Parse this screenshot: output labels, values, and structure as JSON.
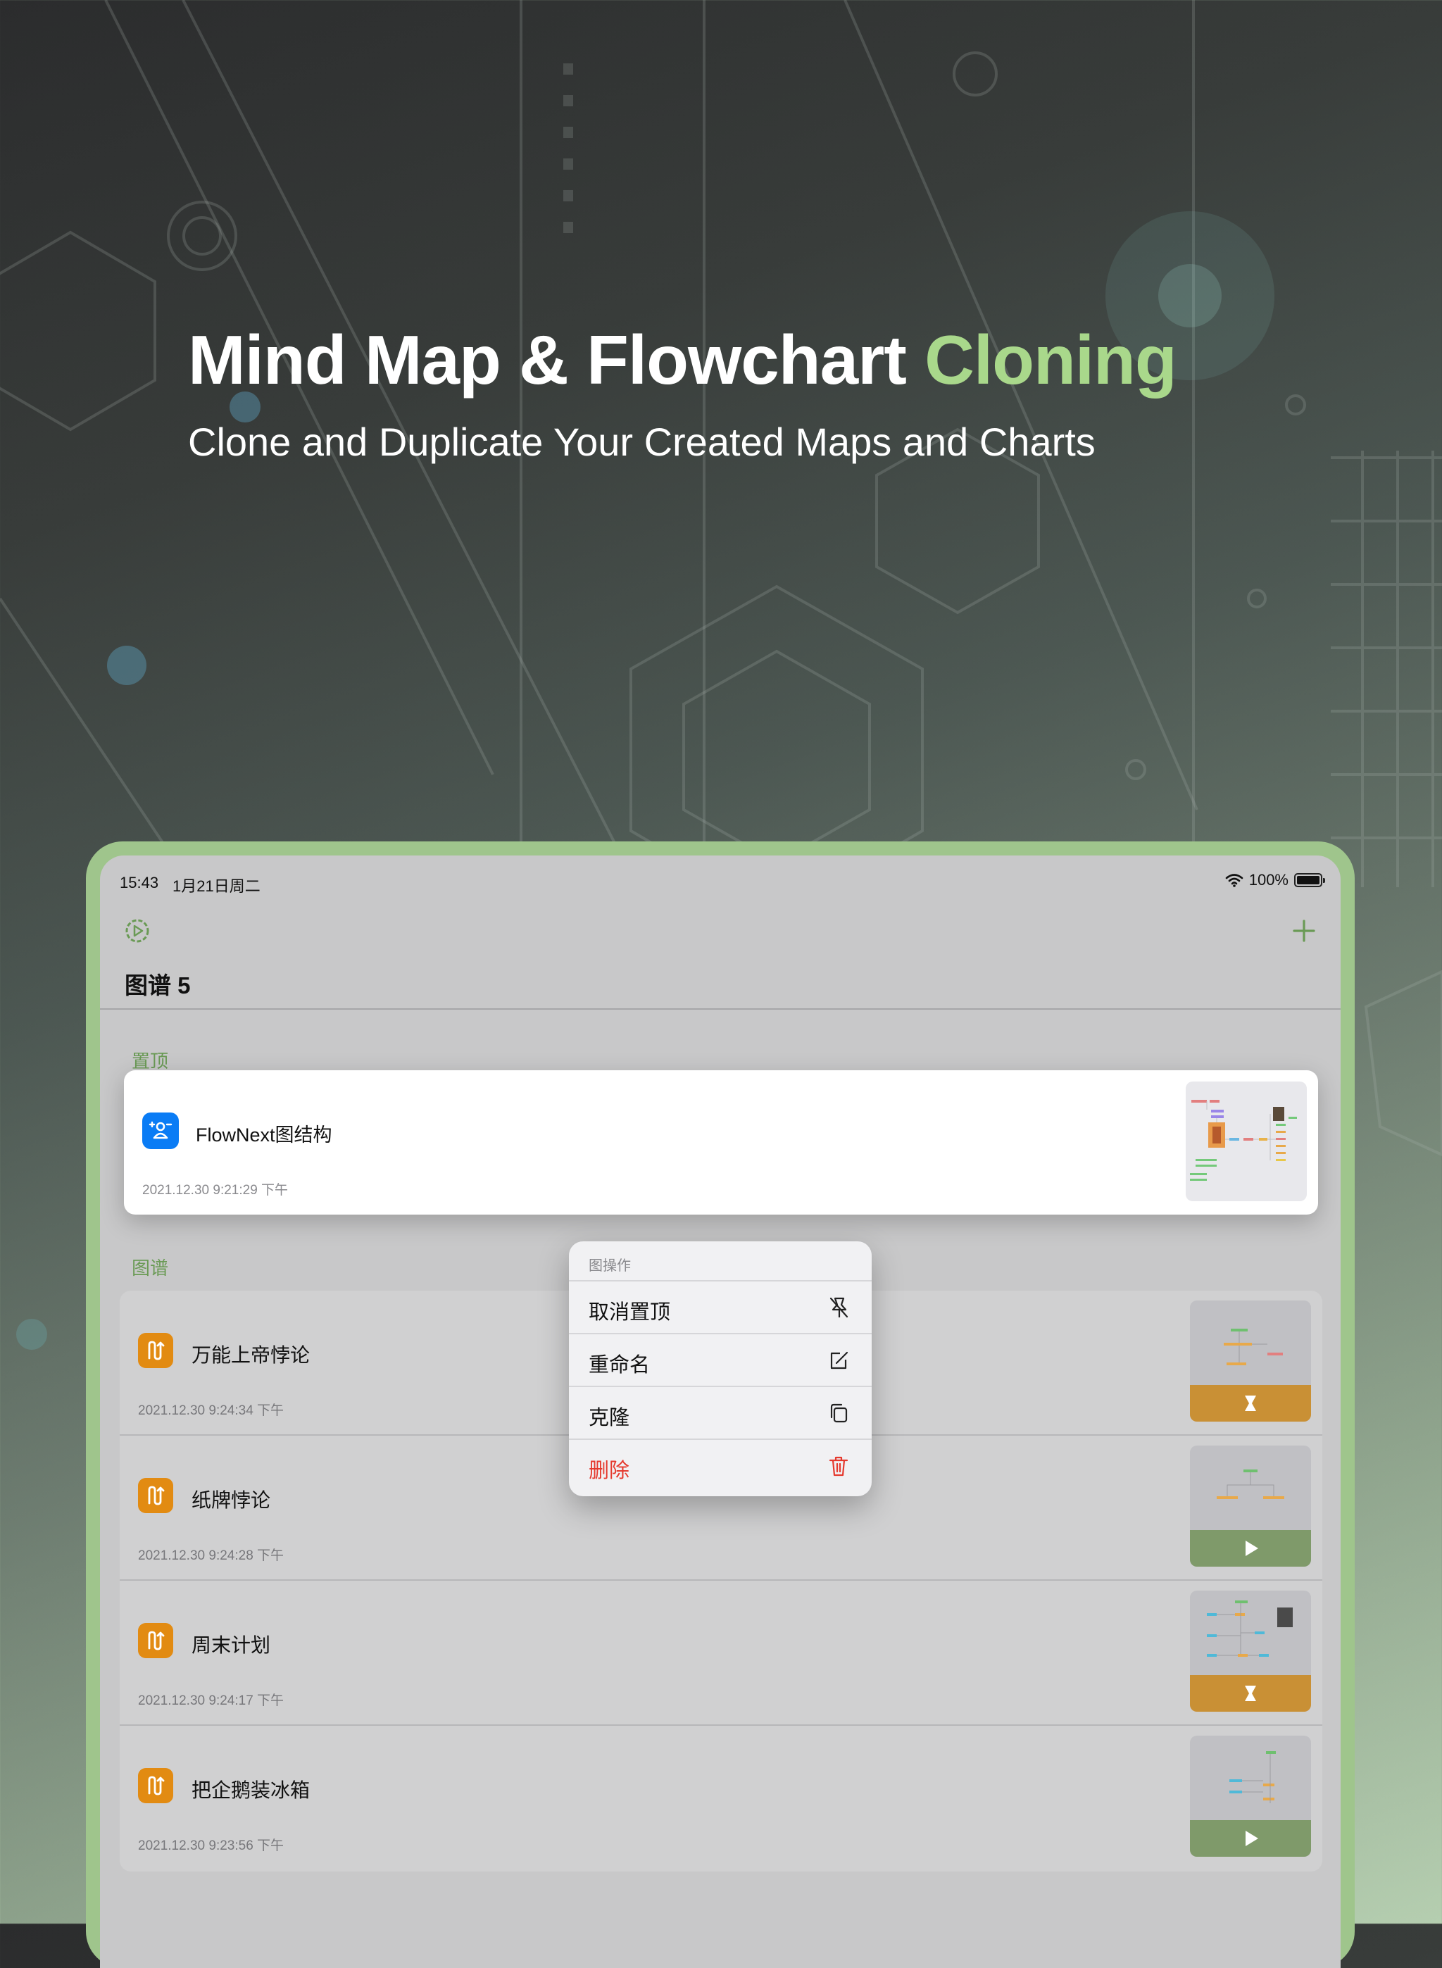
{
  "hero": {
    "title_main": "Mind Map & Flowchart",
    "title_accent": "Cloning",
    "subtitle": "Clone and Duplicate Your Created Maps and Charts"
  },
  "status_bar": {
    "time": "15:43",
    "date": "1月21日周二",
    "battery": "100%"
  },
  "toolbar": {
    "settings_icon": "settings-icon",
    "add_icon": "plus-icon"
  },
  "page": {
    "title": "图谱 5"
  },
  "pinned": {
    "section_label": "置顶",
    "item": {
      "name": "FlowNext图结构",
      "date": "2021.12.30   9:21:29  下午",
      "icon": "person-network-icon"
    }
  },
  "maps": {
    "section_label": "图谱",
    "items": [
      {
        "name": "万能上帝悖论",
        "date": "2021.12.30   9:24:34  下午",
        "status_icon": "hourglass-icon"
      },
      {
        "name": "纸牌悖论",
        "date": "2021.12.30   9:24:28  下午",
        "status_icon": "play-icon"
      },
      {
        "name": "周末计划",
        "date": "2021.12.30   9:24:17  下午",
        "status_icon": "hourglass-icon"
      },
      {
        "name": "把企鹅装冰箱",
        "date": "2021.12.30   9:23:56  下午",
        "status_icon": "play-icon"
      }
    ]
  },
  "context_menu": {
    "header": "图操作",
    "items": [
      {
        "label": "取消置顶",
        "icon": "unpin-icon"
      },
      {
        "label": "重命名",
        "icon": "edit-icon"
      },
      {
        "label": "克隆",
        "icon": "copy-icon"
      },
      {
        "label": "删除",
        "icon": "trash-icon"
      }
    ]
  },
  "colors": {
    "accent_green": "#a9d88b",
    "section_green": "#6a9a55",
    "pinned_icon_blue": "#0a7cf5",
    "row_icon_orange": "#e28b12",
    "delete_red": "#e5392d"
  }
}
